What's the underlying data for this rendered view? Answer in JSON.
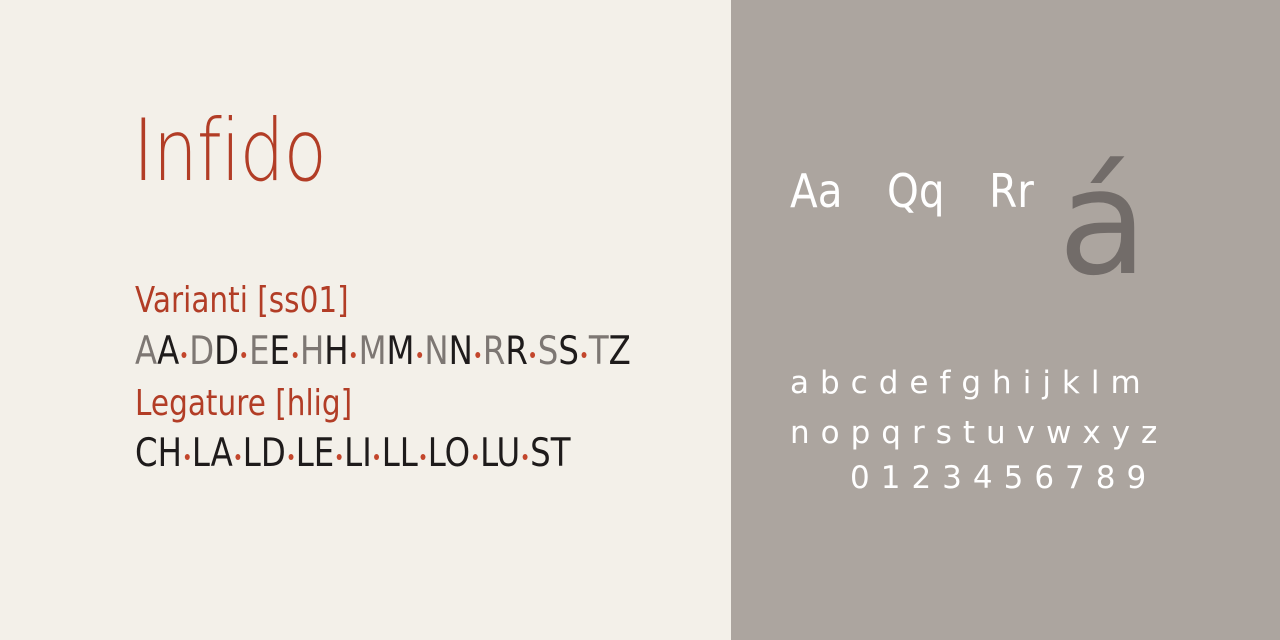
{
  "title": "Infido",
  "variants": {
    "label": "Varianti [ss01]",
    "glyphs": [
      {
        "text": "A",
        "tone": "gray"
      },
      {
        "text": "A",
        "tone": "black"
      },
      {
        "text": "D",
        "tone": "gray"
      },
      {
        "text": "D",
        "tone": "black"
      },
      {
        "text": "E",
        "tone": "gray"
      },
      {
        "text": "E",
        "tone": "black"
      },
      {
        "text": "H",
        "tone": "gray"
      },
      {
        "text": "H",
        "tone": "black"
      },
      {
        "text": "M",
        "tone": "gray"
      },
      {
        "text": "M",
        "tone": "black"
      },
      {
        "text": "N",
        "tone": "gray"
      },
      {
        "text": "N",
        "tone": "black"
      },
      {
        "text": "R",
        "tone": "gray"
      },
      {
        "text": "R",
        "tone": "black"
      },
      {
        "text": "S",
        "tone": "gray"
      },
      {
        "text": "S",
        "tone": "black"
      },
      {
        "text": "T",
        "tone": "gray"
      },
      {
        "text": "Z",
        "tone": "black"
      }
    ]
  },
  "ligatures": {
    "label": "Legature [hlig]",
    "glyphs": [
      "CH",
      "LA",
      "LD",
      "LE",
      "LI",
      "LL",
      "LO",
      "LU",
      "ST"
    ]
  },
  "showcase": {
    "pairs": [
      "Aa",
      "Qq",
      "Rr"
    ],
    "accent": "á",
    "lowercase_1": "abcdefghijklm",
    "lowercase_2": "nopqrstuvwxyz",
    "digits": "0123456789"
  },
  "colors": {
    "left_background": "#f3f0e9",
    "right_background": "#aca59f",
    "accent_red": "#b23d26",
    "glyph_gray": "#7d7773",
    "glyph_black": "#1e1b1b",
    "accent_glyph": "#726c69"
  }
}
